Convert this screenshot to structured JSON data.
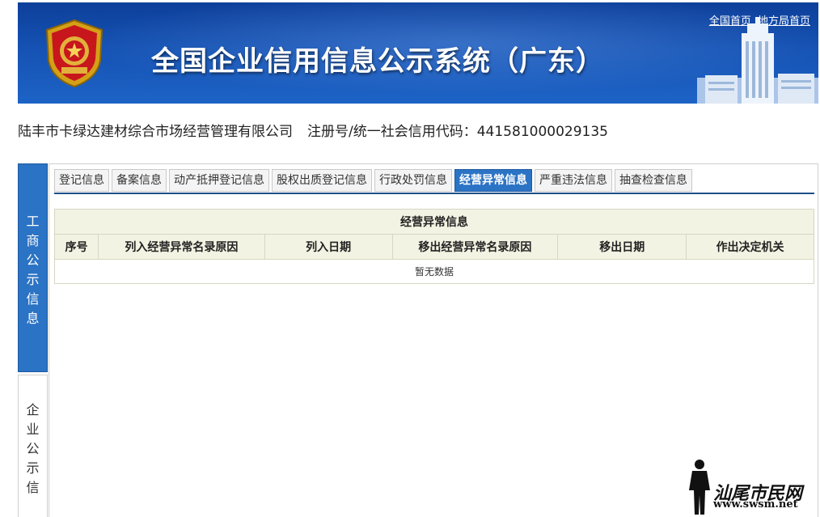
{
  "header": {
    "title": "全国企业信用信息公示系统（广东）",
    "links": [
      "全国首页",
      "地方局首页"
    ]
  },
  "company": {
    "name": "陆丰市卡绿达建材综合市场经营管理有限公司",
    "reg_label": "注册号/统一社会信用代码：",
    "reg_no": "441581000029135"
  },
  "side_tabs": {
    "active": "工商公示信息",
    "inactive": "企业公示信"
  },
  "tabs": [
    "登记信息",
    "备案信息",
    "动产抵押登记信息",
    "股权出质登记信息",
    "行政处罚信息",
    "经营异常信息",
    "严重违法信息",
    "抽查检查信息"
  ],
  "active_tab": "经营异常信息",
  "table": {
    "caption": "经营异常信息",
    "columns": [
      "序号",
      "列入经营异常名录原因",
      "列入日期",
      "移出经营异常名录原因",
      "移出日期",
      "作出决定机关"
    ],
    "empty_text": "暂无数据"
  },
  "watermark": {
    "text": "汕尾市民网",
    "url": "www.swsm.net"
  },
  "colors": {
    "banner": "#1552b3",
    "accent": "#2b73c4",
    "table_header": "#f3f3e3"
  }
}
